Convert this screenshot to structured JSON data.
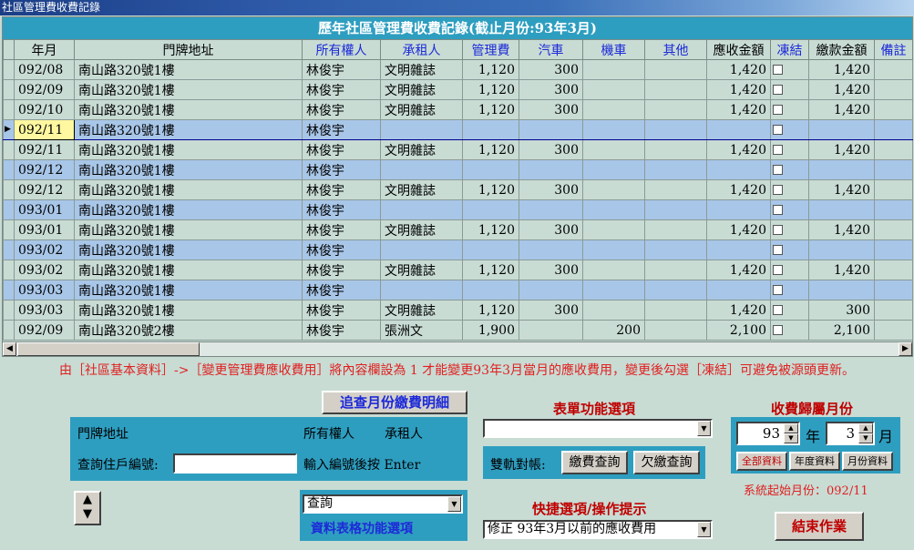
{
  "window": {
    "title": "社區管理費收費記錄"
  },
  "grid": {
    "caption": "歷年社區管理費收費記錄(截止月份:93年3月)",
    "columns": [
      "年月",
      "門牌地址",
      "所有權人",
      "承租人",
      "管理費",
      "汽車",
      "機車",
      "其他",
      "應收金額",
      "凍結",
      "繳款金額",
      "備註"
    ],
    "rows": [
      {
        "ym": "092/08",
        "addr": "南山路320號1樓",
        "owner": "林俊宇",
        "tenant": "文明雜誌",
        "fee": "1,120",
        "car": "300",
        "moto": "",
        "other": "",
        "due": "1,420",
        "paid": "1,420",
        "note": ""
      },
      {
        "ym": "092/09",
        "addr": "南山路320號1樓",
        "owner": "林俊宇",
        "tenant": "文明雜誌",
        "fee": "1,120",
        "car": "300",
        "moto": "",
        "other": "",
        "due": "1,420",
        "paid": "1,420",
        "note": ""
      },
      {
        "ym": "092/10",
        "addr": "南山路320號1樓",
        "owner": "林俊宇",
        "tenant": "文明雜誌",
        "fee": "1,120",
        "car": "300",
        "moto": "",
        "other": "",
        "due": "1,420",
        "paid": "1,420",
        "note": ""
      },
      {
        "ym": "092/11",
        "addr": "南山路320號1樓",
        "owner": "林俊宇",
        "tenant": "",
        "fee": "",
        "car": "",
        "moto": "",
        "other": "",
        "due": "",
        "paid": "",
        "note": ""
      },
      {
        "ym": "092/11",
        "addr": "南山路320號1樓",
        "owner": "林俊宇",
        "tenant": "文明雜誌",
        "fee": "1,120",
        "car": "300",
        "moto": "",
        "other": "",
        "due": "1,420",
        "paid": "1,420",
        "note": ""
      },
      {
        "ym": "092/12",
        "addr": "南山路320號1樓",
        "owner": "林俊宇",
        "tenant": "",
        "fee": "",
        "car": "",
        "moto": "",
        "other": "",
        "due": "",
        "paid": "",
        "note": ""
      },
      {
        "ym": "092/12",
        "addr": "南山路320號1樓",
        "owner": "林俊宇",
        "tenant": "文明雜誌",
        "fee": "1,120",
        "car": "300",
        "moto": "",
        "other": "",
        "due": "1,420",
        "paid": "1,420",
        "note": ""
      },
      {
        "ym": "093/01",
        "addr": "南山路320號1樓",
        "owner": "林俊宇",
        "tenant": "",
        "fee": "",
        "car": "",
        "moto": "",
        "other": "",
        "due": "",
        "paid": "",
        "note": ""
      },
      {
        "ym": "093/01",
        "addr": "南山路320號1樓",
        "owner": "林俊宇",
        "tenant": "文明雜誌",
        "fee": "1,120",
        "car": "300",
        "moto": "",
        "other": "",
        "due": "1,420",
        "paid": "1,420",
        "note": ""
      },
      {
        "ym": "093/02",
        "addr": "南山路320號1樓",
        "owner": "林俊宇",
        "tenant": "",
        "fee": "",
        "car": "",
        "moto": "",
        "other": "",
        "due": "",
        "paid": "",
        "note": ""
      },
      {
        "ym": "093/02",
        "addr": "南山路320號1樓",
        "owner": "林俊宇",
        "tenant": "文明雜誌",
        "fee": "1,120",
        "car": "300",
        "moto": "",
        "other": "",
        "due": "1,420",
        "paid": "1,420",
        "note": ""
      },
      {
        "ym": "093/03",
        "addr": "南山路320號1樓",
        "owner": "林俊宇",
        "tenant": "",
        "fee": "",
        "car": "",
        "moto": "",
        "other": "",
        "due": "",
        "paid": "",
        "note": ""
      },
      {
        "ym": "093/03",
        "addr": "南山路320號1樓",
        "owner": "林俊宇",
        "tenant": "文明雜誌",
        "fee": "1,120",
        "car": "300",
        "moto": "",
        "other": "",
        "due": "1,420",
        "paid": "300",
        "note": ""
      },
      {
        "ym": "092/09",
        "addr": "南山路320號2樓",
        "owner": "林俊宇",
        "tenant": "張洲文",
        "fee": "1,900",
        "car": "",
        "moto": "200",
        "other": "",
        "due": "2,100",
        "paid": "2,100",
        "note": ""
      }
    ]
  },
  "notice": "由［社區基本資料］->［變更管理費應收費用］將內容欄設為 1 才能變更93年3月當月的應收費用，變更後勾選［凍結］可避免被源頭更新。",
  "lookup": {
    "button": "追查月份繳費明細",
    "addr_label": "門牌地址",
    "owner_label": "所有權人",
    "tenant_label": "承租人",
    "query_label": "查詢住戶編號:",
    "query_value": "",
    "hint": "輸入編號後按 Enter"
  },
  "grid_options": {
    "selected": "查詢",
    "label": "資料表格功能選項"
  },
  "form_functions": {
    "title": "表單功能選項",
    "selected": "",
    "dual_label": "雙軌對帳:",
    "fee_query": "繳費查詢",
    "arrears_query": "欠繳查詢"
  },
  "quick": {
    "title": "快捷選項/操作提示",
    "selected": "修正 93年3月以前的應收費用"
  },
  "billing_month": {
    "title": "收費歸屬月份",
    "year": "93",
    "year_unit": "年",
    "month": "3",
    "month_unit": "月",
    "btn_all": "全部資料",
    "btn_year": "年度資料",
    "btn_month": "月份資料",
    "start_label": "系統起始月份：092/11"
  },
  "exit_button": "結束作業",
  "colors": {
    "caption_bg": "#2e9ec0",
    "row_alt": "#a8c6e8",
    "row_base": "#c8dcd4",
    "notice": "#e02020",
    "accent_blue": "#1d2ad8"
  }
}
